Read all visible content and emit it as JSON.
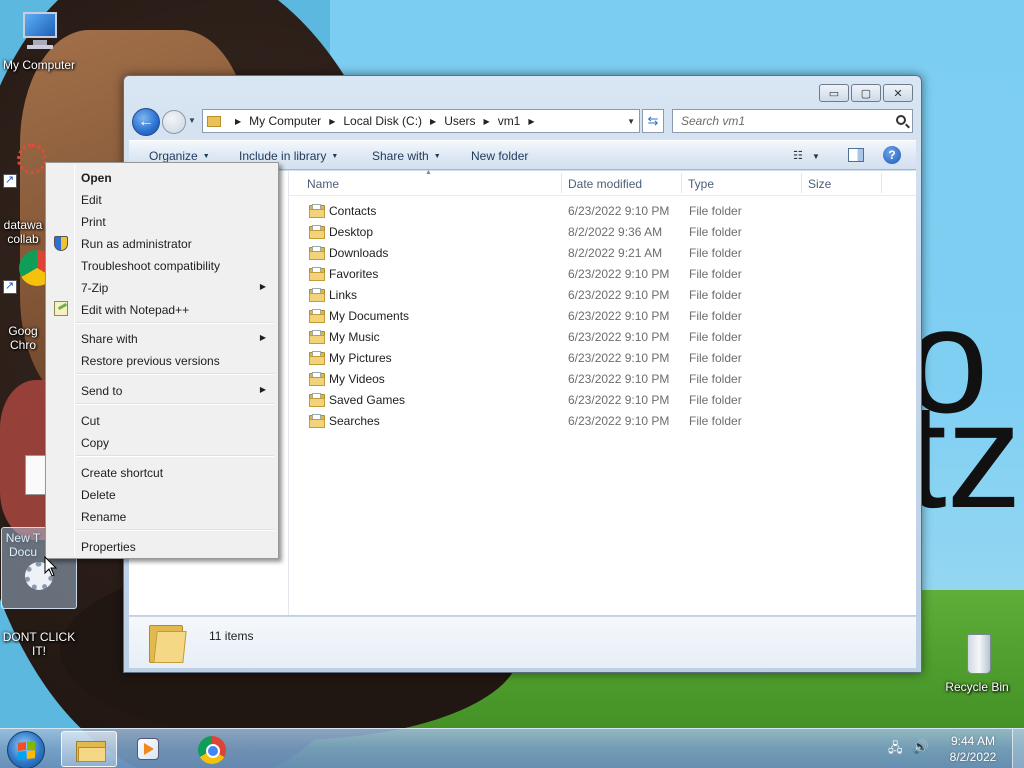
{
  "desktop": {
    "icons": [
      {
        "label": "My Computer"
      },
      {
        "label": "datawa\ncollab"
      },
      {
        "label": "Goog\nChro"
      },
      {
        "label": "New T\nDocu"
      },
      {
        "label": "DONT CLICK\nIT!"
      },
      {
        "label": "Recycle Bin"
      }
    ]
  },
  "window": {
    "controls": {
      "minimize": "▭",
      "maximize": "▢",
      "close": "✕"
    },
    "address": {
      "crumbs": [
        "My Computer",
        "Local Disk (C:)",
        "Users",
        "vm1"
      ]
    },
    "search": {
      "placeholder": "Search vm1"
    },
    "toolbar": {
      "organize": "Organize",
      "include_in_library": "Include in library",
      "share_with": "Share with",
      "new_folder": "New folder",
      "help": "?"
    },
    "columns": {
      "name": "Name",
      "date": "Date modified",
      "type": "Type",
      "size": "Size"
    },
    "files": [
      {
        "name": "Contacts",
        "date": "6/23/2022 9:10 PM",
        "type": "File folder"
      },
      {
        "name": "Desktop",
        "date": "8/2/2022 9:36 AM",
        "type": "File folder"
      },
      {
        "name": "Downloads",
        "date": "8/2/2022 9:21 AM",
        "type": "File folder"
      },
      {
        "name": "Favorites",
        "date": "6/23/2022 9:10 PM",
        "type": "File folder"
      },
      {
        "name": "Links",
        "date": "6/23/2022 9:10 PM",
        "type": "File folder"
      },
      {
        "name": "My Documents",
        "date": "6/23/2022 9:10 PM",
        "type": "File folder"
      },
      {
        "name": "My Music",
        "date": "6/23/2022 9:10 PM",
        "type": "File folder"
      },
      {
        "name": "My Pictures",
        "date": "6/23/2022 9:10 PM",
        "type": "File folder"
      },
      {
        "name": "My Videos",
        "date": "6/23/2022 9:10 PM",
        "type": "File folder"
      },
      {
        "name": "Saved Games",
        "date": "6/23/2022 9:10 PM",
        "type": "File folder"
      },
      {
        "name": "Searches",
        "date": "6/23/2022 9:10 PM",
        "type": "File folder"
      }
    ],
    "status": {
      "item_count": "11 items"
    }
  },
  "context_menu": {
    "items": [
      {
        "label": "Open",
        "bold": true
      },
      {
        "label": "Edit"
      },
      {
        "label": "Print"
      },
      {
        "label": "Run as administrator",
        "icon": "uac-shield-icon"
      },
      {
        "label": "Troubleshoot compatibility"
      },
      {
        "label": "7-Zip",
        "submenu": true
      },
      {
        "label": "Edit with Notepad++",
        "icon": "notepad-plus-plus-icon"
      },
      {
        "label": "Share with",
        "submenu": true
      },
      {
        "label": "Restore previous versions"
      },
      {
        "label": "Send to",
        "submenu": true
      },
      {
        "label": "Cut"
      },
      {
        "label": "Copy"
      },
      {
        "label": "Create shortcut"
      },
      {
        "label": "Delete"
      },
      {
        "label": "Rename"
      },
      {
        "label": "Properties"
      }
    ]
  },
  "taskbar": {
    "clock": {
      "time": "9:44 AM",
      "date": "8/2/2022"
    },
    "apps": [
      "windows-explorer-icon",
      "media-player-icon",
      "chrome-icon"
    ]
  },
  "colors": {
    "accent": "#2a6fd0",
    "menu_bg": "#f0f0f0",
    "taskbar": "#789ec4"
  }
}
